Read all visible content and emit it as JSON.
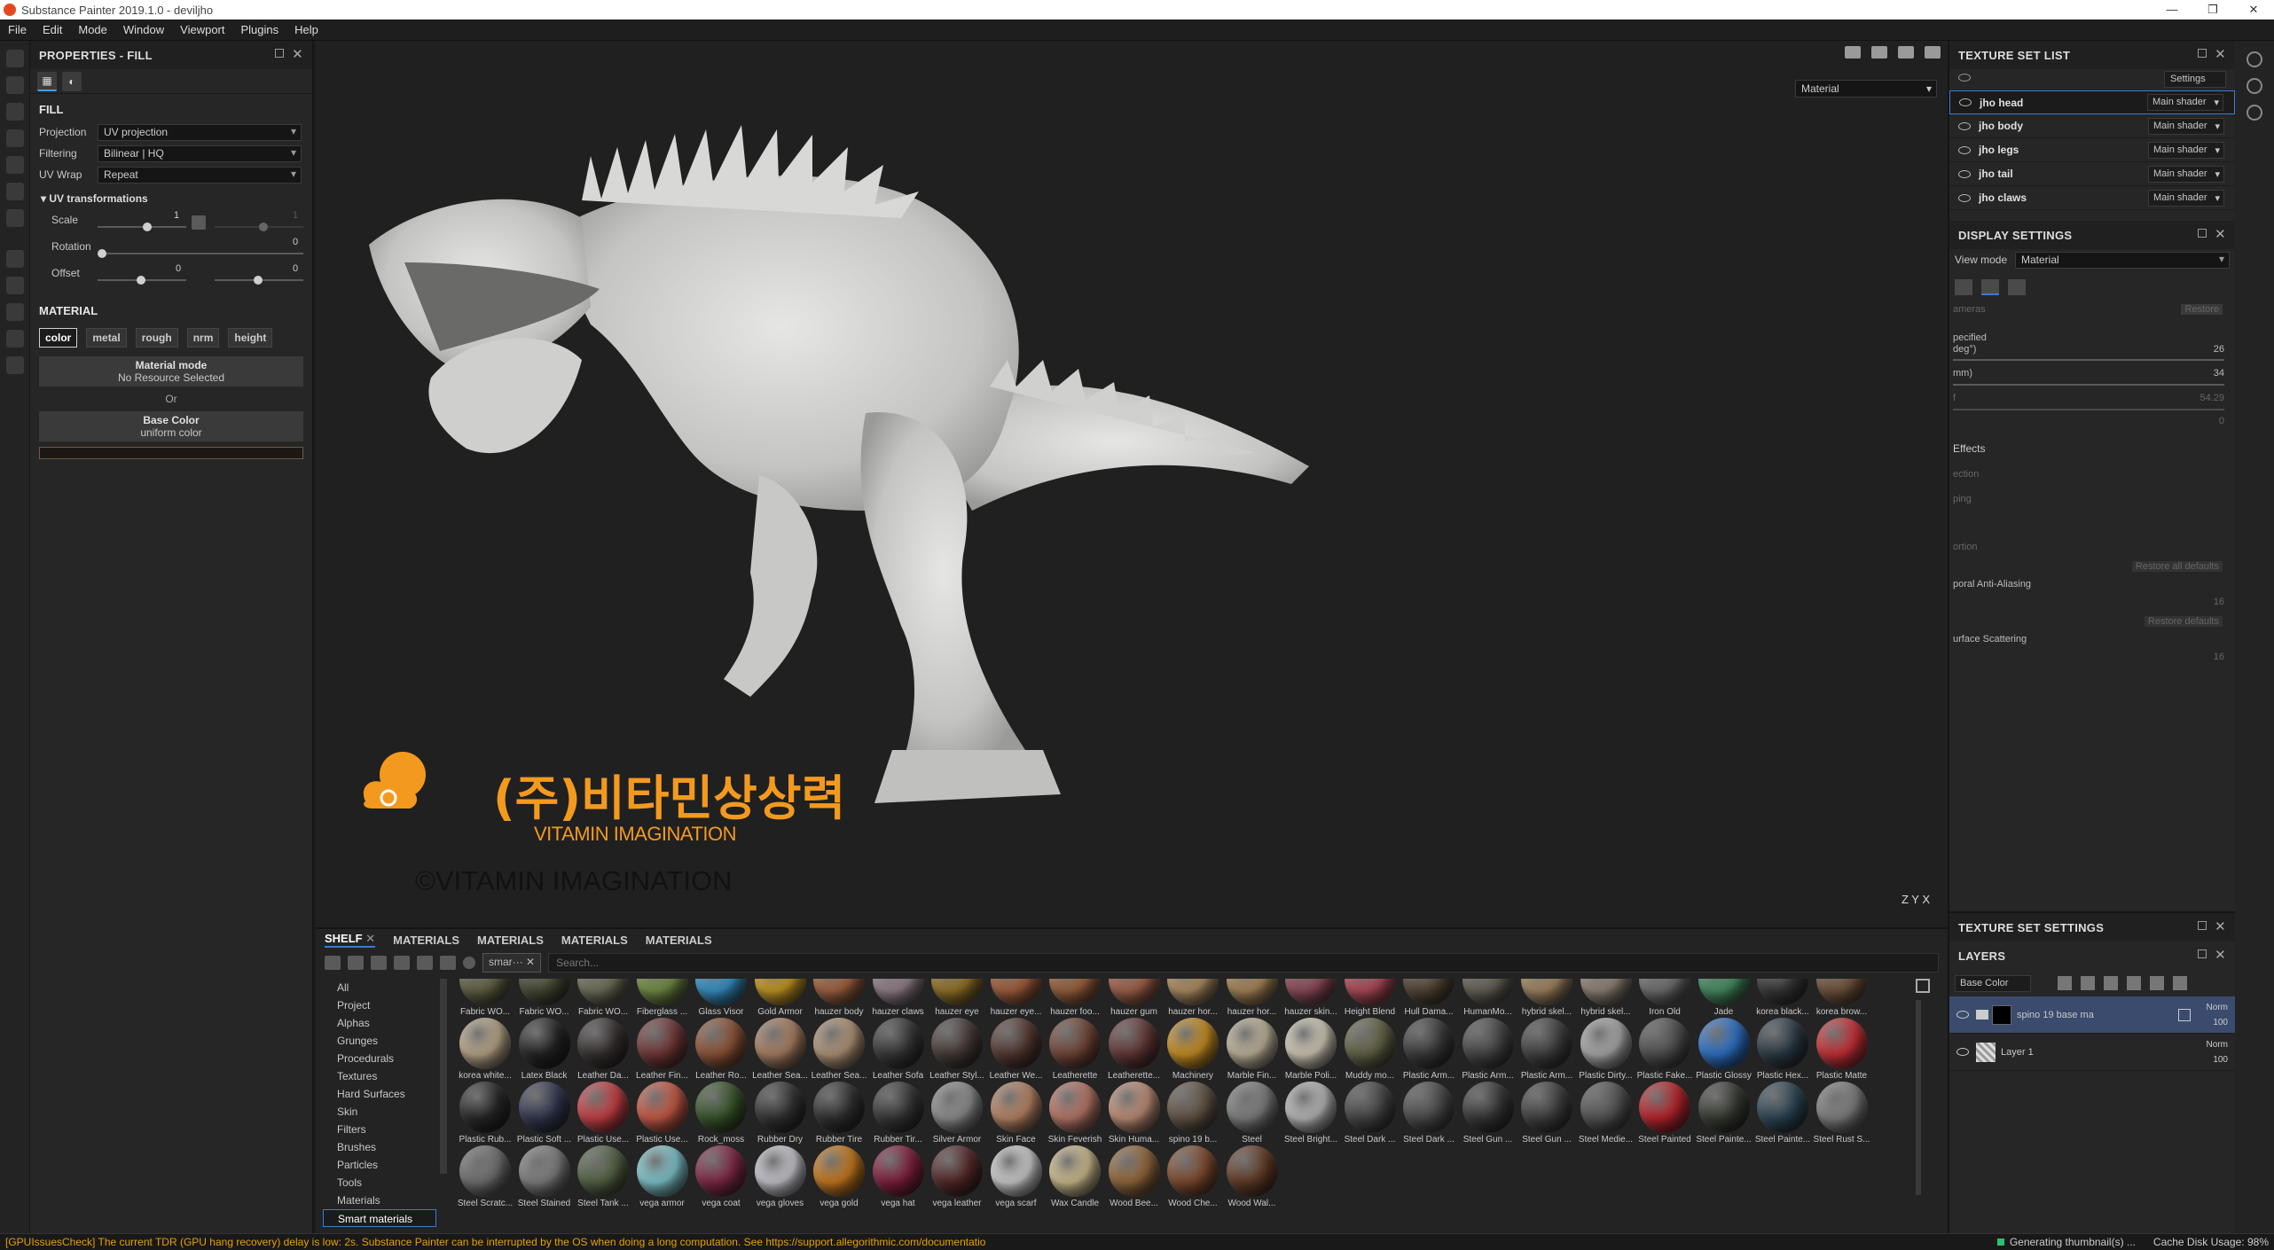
{
  "window": {
    "title": "Substance Painter 2019.1.0 - deviljho"
  },
  "menu": [
    "File",
    "Edit",
    "Mode",
    "Window",
    "Viewport",
    "Plugins",
    "Help"
  ],
  "properties": {
    "title": "PROPERTIES - FILL",
    "fill_label": "FILL",
    "projection_label": "Projection",
    "projection_value": "UV projection",
    "filtering_label": "Filtering",
    "filtering_value": "Bilinear | HQ",
    "uvwrap_label": "UV Wrap",
    "uvwrap_value": "Repeat",
    "uv_transform_label": "UV transformations",
    "scale_label": "Scale",
    "scale_value": "1",
    "scale_value2": "1",
    "rotation_label": "Rotation",
    "rotation_value": "0",
    "offset_label": "Offset",
    "offset_value_u": "0",
    "offset_value_v": "0",
    "material_label": "MATERIAL",
    "channels": [
      "color",
      "metal",
      "rough",
      "nrm",
      "height"
    ],
    "material_mode_label": "Material mode",
    "material_mode_value": "No Resource Selected",
    "or_label": "Or",
    "base_color_label": "Base Color",
    "base_color_value": "uniform color"
  },
  "viewport": {
    "mode": "Material",
    "axis": "Z   Y   X"
  },
  "logo": {
    "korean": "(주)비타민상상력",
    "english": "VITAMIN IMAGINATION",
    "copyright": "©VITAMIN IMAGINATION"
  },
  "texture_set_list": {
    "title": "TEXTURE SET LIST",
    "settings_label": "Settings",
    "items": [
      {
        "name": "jho head",
        "shader": "Main shader"
      },
      {
        "name": "jho body",
        "shader": "Main shader"
      },
      {
        "name": "jho legs",
        "shader": "Main shader"
      },
      {
        "name": "jho tail",
        "shader": "Main shader"
      },
      {
        "name": "jho claws",
        "shader": "Main shader"
      }
    ]
  },
  "display_settings": {
    "title": "DISPLAY SETTINGS",
    "view_mode_label": "View mode",
    "view_mode_value": "Material",
    "ghost_texts": [
      "ameras",
      "Restore",
      "pecified",
      "deg°)",
      "26",
      "mm)",
      "34",
      "f",
      "54.29",
      "0",
      "Effects",
      "ection",
      "ping",
      "ortion",
      "Restore all defaults",
      "poral Anti-Aliasing",
      "16",
      "Restore defaults",
      "urface Scattering",
      "16"
    ]
  },
  "shelf": {
    "tabs": [
      "SHELF",
      "MATERIALS",
      "MATERIALS",
      "MATERIALS",
      "MATERIALS"
    ],
    "filter_text": "smar···",
    "search_placeholder": "Search...",
    "categories": [
      "All",
      "Project",
      "Alphas",
      "Grunges",
      "Procedurals",
      "Textures",
      "Hard Surfaces",
      "Skin",
      "Filters",
      "Brushes",
      "Particles",
      "Tools",
      "Materials",
      "Smart materials"
    ],
    "materials": [
      {
        "name": "Fabric WO...",
        "color": "#6b6a4a"
      },
      {
        "name": "Fabric WO...",
        "color": "#4d5038"
      },
      {
        "name": "Fabric WO...",
        "color": "#7a7a62"
      },
      {
        "name": "Fiberglass ...",
        "color": "#7e9a4b"
      },
      {
        "name": "Glass Visor",
        "color": "#3aa0d8"
      },
      {
        "name": "Gold Armor",
        "color": "#d6a524"
      },
      {
        "name": "hauzer body",
        "color": "#b06a45"
      },
      {
        "name": "hauzer claws",
        "color": "#a08a95"
      },
      {
        "name": "hauzer eye",
        "color": "#a27d2a"
      },
      {
        "name": "hauzer eye...",
        "color": "#b06640"
      },
      {
        "name": "hauzer foo...",
        "color": "#a86842"
      },
      {
        "name": "hauzer gum",
        "color": "#b26a50"
      },
      {
        "name": "hauzer hor...",
        "color": "#c09a6a"
      },
      {
        "name": "hauzer hor...",
        "color": "#b8925f"
      },
      {
        "name": "hauzer skin...",
        "color": "#9a5060"
      },
      {
        "name": "Height Blend",
        "color": "#c05060"
      },
      {
        "name": "Hull Dama...",
        "color": "#5a4a3a"
      },
      {
        "name": "HumanMo...",
        "color": "#6e6a5e"
      },
      {
        "name": "hybrid skel...",
        "color": "#b0926a"
      },
      {
        "name": "hybrid skel...",
        "color": "#9c9080"
      },
      {
        "name": "Iron Old",
        "color": "#7a7a7a"
      },
      {
        "name": "Jade",
        "color": "#4a9a6a"
      },
      {
        "name": "korea black...",
        "color": "#3c3c3c"
      },
      {
        "name": "korea brow...",
        "color": "#7a5a40"
      },
      {
        "name": "korea white...",
        "color": "#c8b494"
      },
      {
        "name": "Latex Black",
        "color": "#262626"
      },
      {
        "name": "Leather Da...",
        "color": "#3a3333"
      },
      {
        "name": "Leather Fin...",
        "color": "#7a3a3a"
      },
      {
        "name": "Leather Ro...",
        "color": "#9a5a3a"
      },
      {
        "name": "Leather Sea...",
        "color": "#b88a6a"
      },
      {
        "name": "Leather Sea...",
        "color": "#c0a080"
      },
      {
        "name": "Leather Sofa",
        "color": "#3a3a3a"
      },
      {
        "name": "Leather Styl...",
        "color": "#4a3e3a"
      },
      {
        "name": "Leather We...",
        "color": "#5a3a34"
      },
      {
        "name": "Leatherette",
        "color": "#7a4a3a"
      },
      {
        "name": "Leatherette...",
        "color": "#6a3a3a"
      },
      {
        "name": "Machinery",
        "color": "#d99a24"
      },
      {
        "name": "Marble Fin...",
        "color": "#d0c4a8"
      },
      {
        "name": "Marble Poli...",
        "color": "#e4dcc8"
      },
      {
        "name": "Muddy mo...",
        "color": "#6a6a4a"
      },
      {
        "name": "Plastic Arm...",
        "color": "#3e3e3e"
      },
      {
        "name": "Plastic Arm...",
        "color": "#4a4a4a"
      },
      {
        "name": "Plastic Arm...",
        "color": "#444444"
      },
      {
        "name": "Plastic Dirty...",
        "color": "#b8b8b8"
      },
      {
        "name": "Plastic Fake...",
        "color": "#555555"
      },
      {
        "name": "Plastic Glossy",
        "color": "#2f7ad8"
      },
      {
        "name": "Plastic Hex...",
        "color": "#2e3e4a"
      },
      {
        "name": "Plastic Matte",
        "color": "#d8333a"
      },
      {
        "name": "Plastic Rub...",
        "color": "#2a2a2a"
      },
      {
        "name": "Plastic Soft ...",
        "color": "#353a55"
      },
      {
        "name": "Plastic Use...",
        "color": "#d8444a"
      },
      {
        "name": "Plastic Use...",
        "color": "#d8604a"
      },
      {
        "name": "Rock_moss",
        "color": "#3a5a2a"
      },
      {
        "name": "Rubber Dry",
        "color": "#363636"
      },
      {
        "name": "Rubber Tire",
        "color": "#333333"
      },
      {
        "name": "Rubber Tir...",
        "color": "#3a3a3a"
      },
      {
        "name": "Silver Armor",
        "color": "#9a9a9a"
      },
      {
        "name": "Skin Face",
        "color": "#c8906e"
      },
      {
        "name": "Skin Feverish",
        "color": "#c88070"
      },
      {
        "name": "Skin Huma...",
        "color": "#d09a80"
      },
      {
        "name": "spino 19 b...",
        "color": "#6a5a4a"
      },
      {
        "name": "Steel",
        "color": "#8a8a8a"
      },
      {
        "name": "Steel Bright...",
        "color": "#c8c8c8"
      },
      {
        "name": "Steel Dark ...",
        "color": "#4a4a4a"
      },
      {
        "name": "Steel Dark ...",
        "color": "#505050"
      },
      {
        "name": "Steel Gun ...",
        "color": "#3a3a3a"
      },
      {
        "name": "Steel Gun ...",
        "color": "#444444"
      },
      {
        "name": "Steel Medie...",
        "color": "#5a5a5a"
      },
      {
        "name": "Steel Painted",
        "color": "#c8262e"
      },
      {
        "name": "Steel Painte...",
        "color": "#3a3e34"
      },
      {
        "name": "Steel Painte...",
        "color": "#2e4a5a"
      },
      {
        "name": "Steel Rust S...",
        "color": "#8a8a8a"
      },
      {
        "name": "Steel Scratc...",
        "color": "#7a7a7a"
      },
      {
        "name": "Steel Stained",
        "color": "#8a8a8a"
      },
      {
        "name": "Steel Tank ...",
        "color": "#5a6a4a"
      },
      {
        "name": "vega armor",
        "color": "#8ad8e0"
      },
      {
        "name": "vega coat",
        "color": "#8a2a4a"
      },
      {
        "name": "vega gloves",
        "color": "#d8d8e0"
      },
      {
        "name": "vega gold",
        "color": "#d8821e"
      },
      {
        "name": "vega hat",
        "color": "#8a2040"
      },
      {
        "name": "vega leather",
        "color": "#5a2a2a"
      },
      {
        "name": "vega scarf",
        "color": "#e0e0e0"
      },
      {
        "name": "Wax Candle",
        "color": "#e0cc9a"
      },
      {
        "name": "Wood Bee...",
        "color": "#a07040"
      },
      {
        "name": "Wood Che...",
        "color": "#8a5030"
      },
      {
        "name": "Wood Wal...",
        "color": "#6a4028"
      }
    ]
  },
  "texture_set_settings": {
    "title": "TEXTURE SET SETTINGS"
  },
  "layers": {
    "title": "LAYERS",
    "channel": "Base Color",
    "items": [
      {
        "name": "spino 19 base ma",
        "blend": "Norm",
        "opacity": "100"
      },
      {
        "name": "Layer 1",
        "blend": "Norm",
        "opacity": "100"
      }
    ]
  },
  "status": {
    "error": "[GPUIssuesCheck] The current TDR (GPU hang recovery) delay is low: 2s. Substance Painter can be interrupted by the OS when doing a long computation. See https://support.allegorithmic.com/documentatio",
    "generating": "Generating thumbnail(s) ...",
    "cache": "Cache Disk Usage:",
    "cache_value": "98%"
  },
  "colors": {
    "accent": "#3a7bd5",
    "logo_orange": "#f39a1e",
    "warning": "#e6a200"
  }
}
